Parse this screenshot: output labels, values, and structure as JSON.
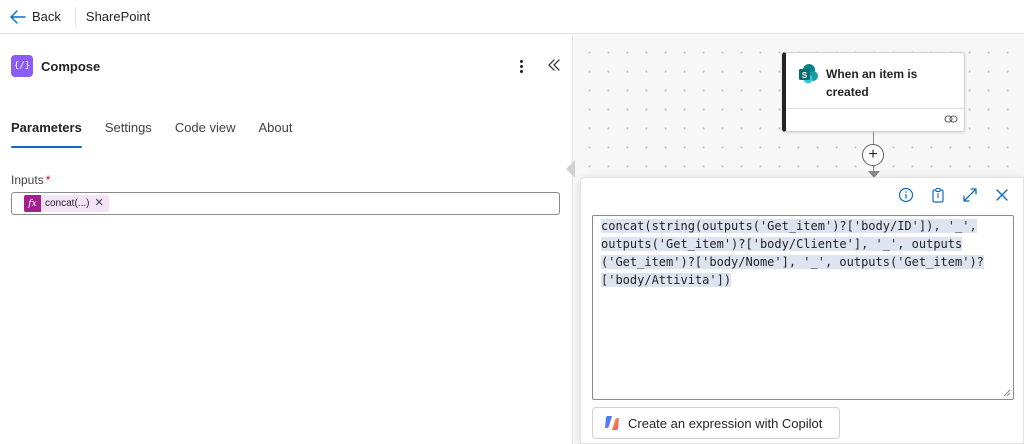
{
  "topbar": {
    "back_label": "Back",
    "title": "SharePoint"
  },
  "action": {
    "title": "Compose",
    "icon": "compose-icon"
  },
  "tabs": [
    {
      "label": "Parameters",
      "active": true
    },
    {
      "label": "Settings",
      "active": false
    },
    {
      "label": "Code view",
      "active": false
    },
    {
      "label": "About",
      "active": false
    }
  ],
  "inputs": {
    "label": "Inputs",
    "required_mark": "*",
    "token_label": "concat(...)",
    "token_remove": "✕"
  },
  "canvas": {
    "trigger_title": "When an item is created",
    "add_symbol": "+"
  },
  "expression": {
    "lines": [
      "concat(string(outputs('Get_item')?['body/ID']), '_',",
      "outputs('Get_item')?['body/Cliente'], '_', outputs",
      "('Get_item')?['body/Nome'], '_', outputs('Get_item')?",
      "['body/Attivita'])"
    ],
    "copilot_label": "Create an expression with Copilot"
  },
  "colors": {
    "accent": "#0f6cbd",
    "compose_icon_bg": "#8b5cf6",
    "token_icon_bg": "#a21f8e",
    "token_bg": "#f3e3f7",
    "sharepoint_teal": "#038387"
  }
}
